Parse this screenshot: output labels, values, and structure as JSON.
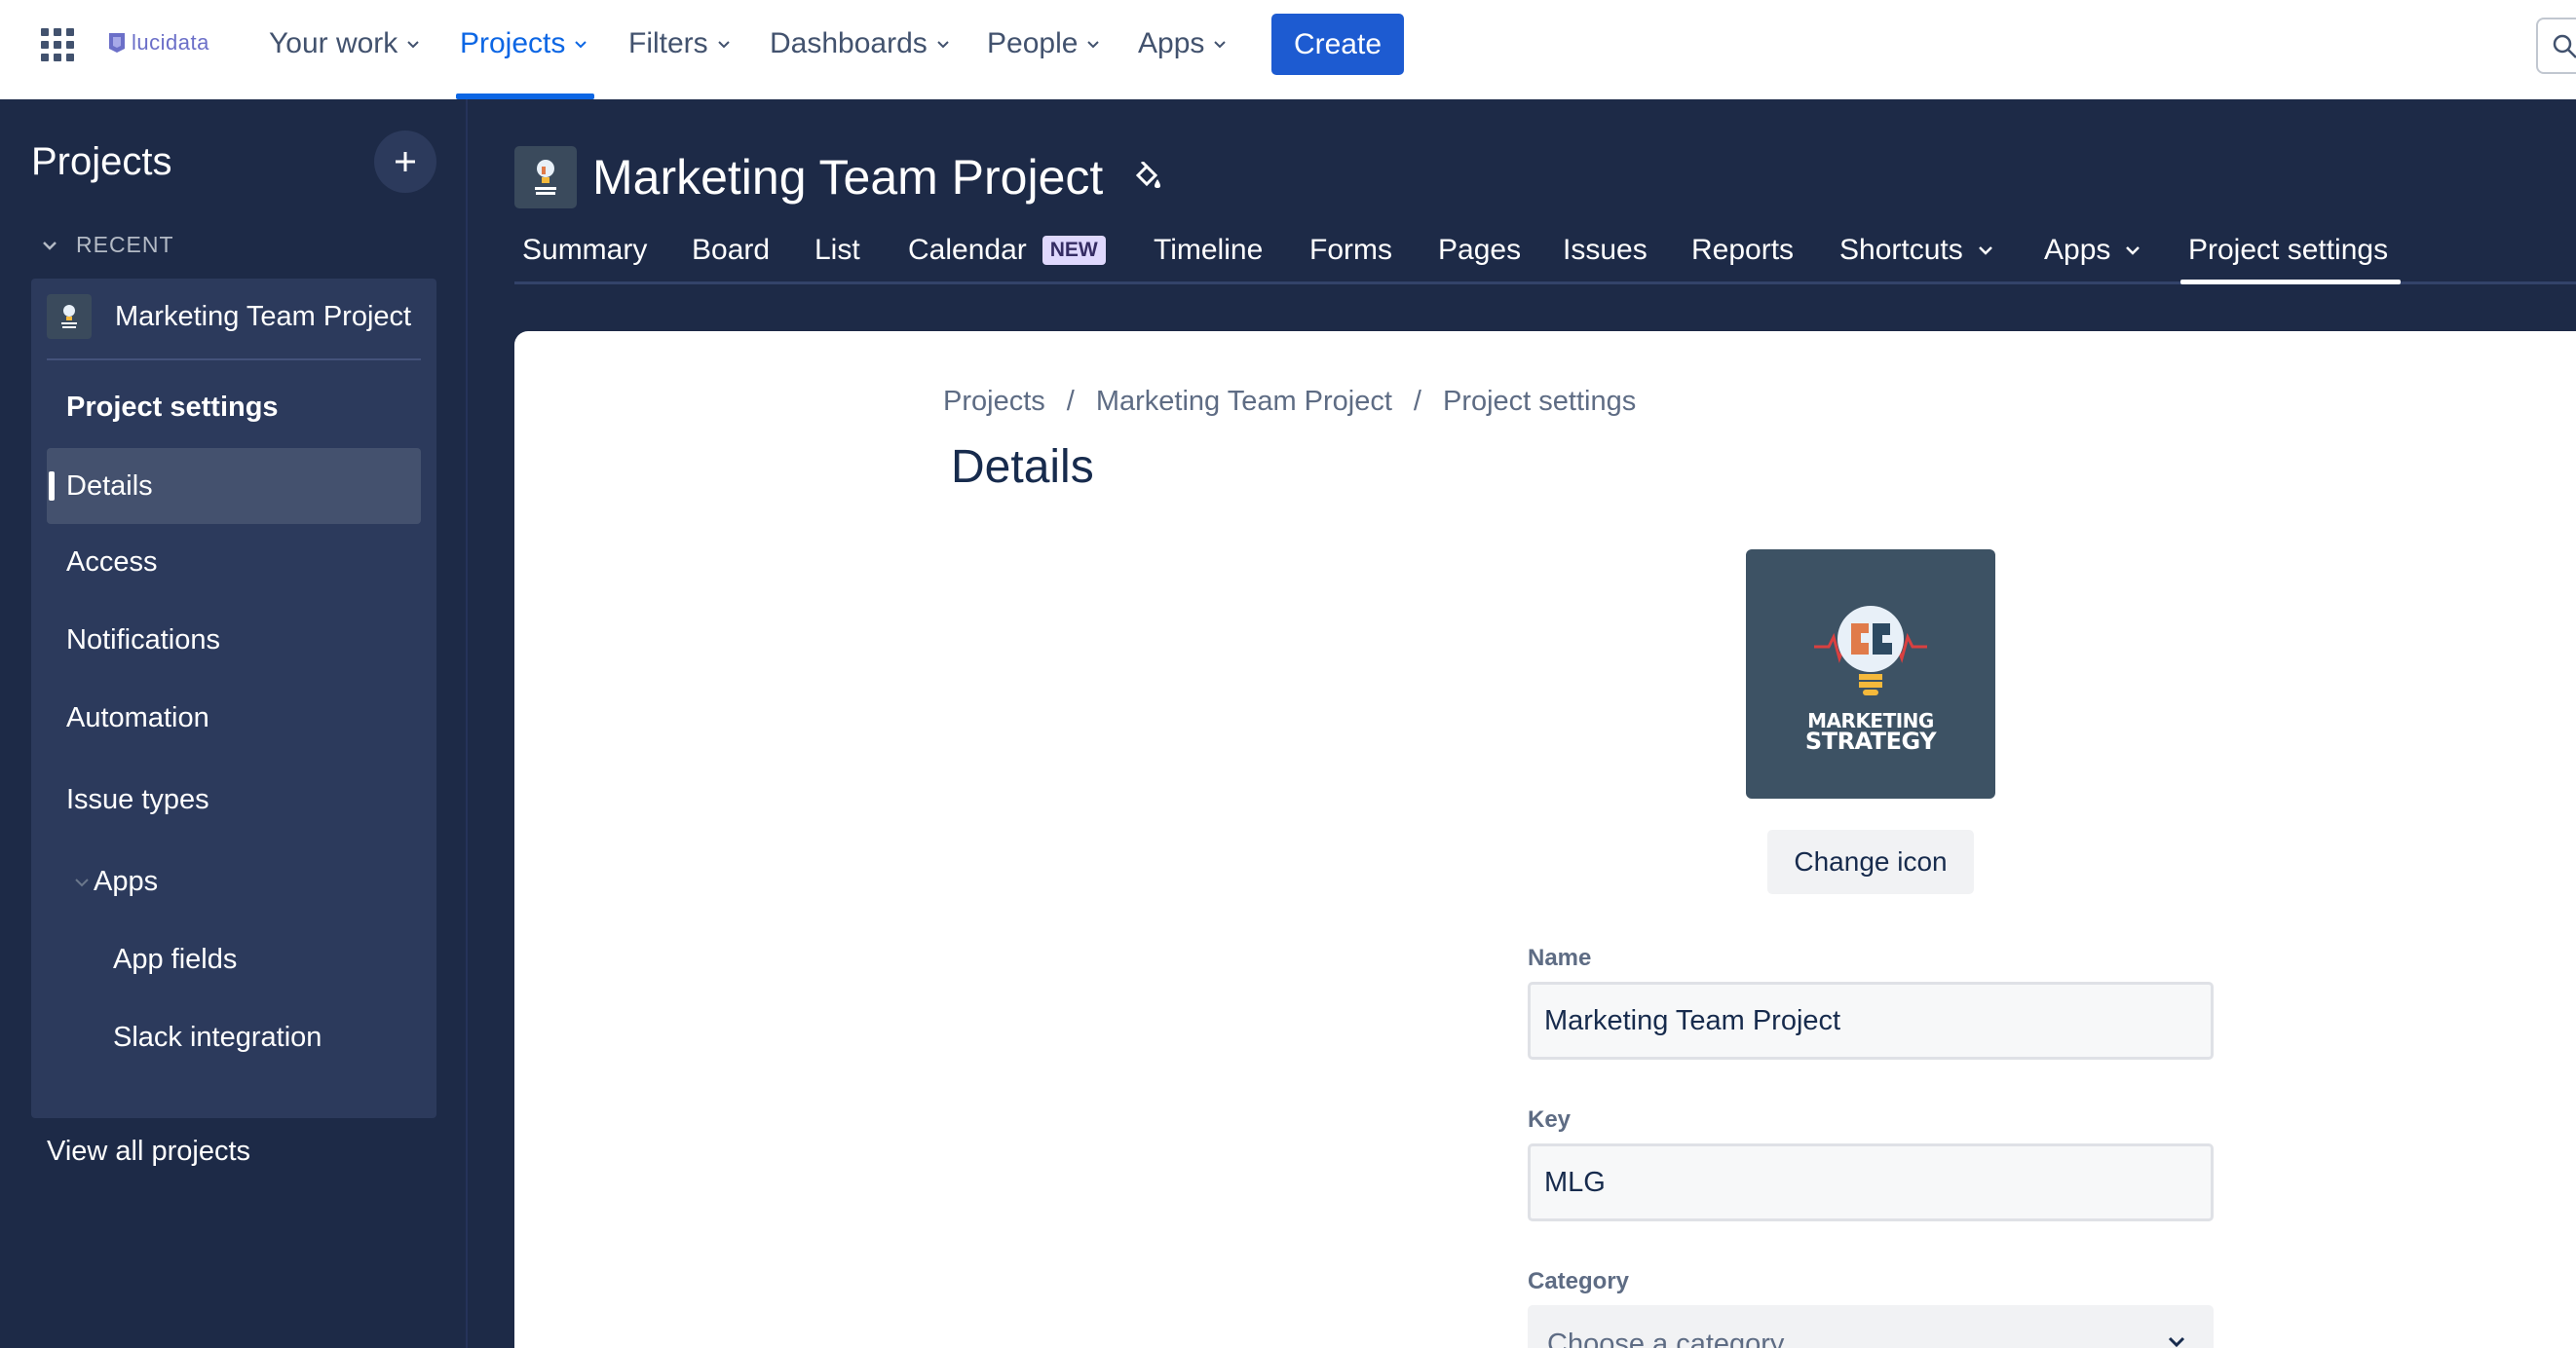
{
  "topnav": {
    "brand": "lucidata",
    "items": [
      {
        "label": "Your work"
      },
      {
        "label": "Projects"
      },
      {
        "label": "Filters"
      },
      {
        "label": "Dashboards"
      },
      {
        "label": "People"
      },
      {
        "label": "Apps"
      }
    ],
    "active_item": "Projects",
    "create_label": "Create"
  },
  "sidebar": {
    "title": "Projects",
    "recent_label": "RECENT",
    "recent_project": "Marketing Team Project",
    "section_title": "Project settings",
    "items": [
      {
        "label": "Details"
      },
      {
        "label": "Access"
      },
      {
        "label": "Notifications"
      },
      {
        "label": "Automation"
      },
      {
        "label": "Issue types"
      },
      {
        "label": "Apps"
      },
      {
        "label": "App fields"
      },
      {
        "label": "Slack integration"
      }
    ],
    "selected_item": "Details",
    "view_all": "View all projects"
  },
  "project": {
    "title": "Marketing Team Project",
    "tabs": [
      {
        "label": "Summary"
      },
      {
        "label": "Board"
      },
      {
        "label": "List"
      },
      {
        "label": "Calendar",
        "badge": "NEW"
      },
      {
        "label": "Timeline"
      },
      {
        "label": "Forms"
      },
      {
        "label": "Pages"
      },
      {
        "label": "Issues"
      },
      {
        "label": "Reports"
      },
      {
        "label": "Shortcuts"
      },
      {
        "label": "Apps"
      },
      {
        "label": "Project settings"
      }
    ],
    "active_tab": "Project settings"
  },
  "main": {
    "breadcrumb": [
      "Projects",
      "Marketing Team Project",
      "Project settings"
    ],
    "heading": "Details",
    "icon_text_line1": "MARKETING",
    "icon_text_line2": "STRATEGY",
    "change_icon_label": "Change icon",
    "fields": {
      "name_label": "Name",
      "name_value": "Marketing Team Project",
      "key_label": "Key",
      "key_value": "MLG",
      "category_label": "Category",
      "category_placeholder": "Choose a category"
    }
  },
  "colors": {
    "accent": "#0c66e4",
    "create_button": "#1d5bd1",
    "sidebar_bg": "#1d2a47",
    "sidebar_panel": "#2c3a5c",
    "badge_bg": "#dfd8fd"
  }
}
